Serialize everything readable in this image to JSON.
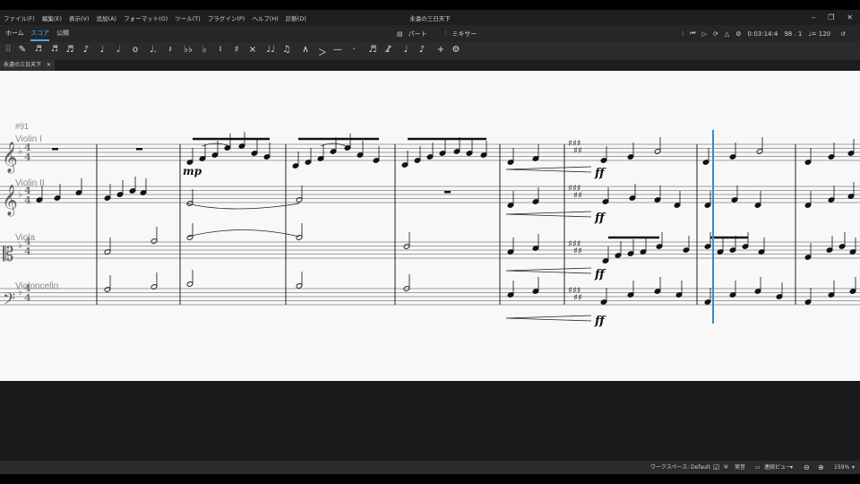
{
  "menu": [
    {
      "label": "ファイル(F)"
    },
    {
      "label": "編集(E)"
    },
    {
      "label": "表示(V)"
    },
    {
      "label": "追加(A)"
    },
    {
      "label": "フォーマット(O)"
    },
    {
      "label": "ツール(T)"
    },
    {
      "label": "プラグイン(P)"
    },
    {
      "label": "ヘルプ(H)"
    },
    {
      "label": "診断(D)"
    }
  ],
  "window": {
    "title": "永遠の三日天下",
    "minimize": "–",
    "restore": "❐",
    "close": "✕"
  },
  "tabs": {
    "home": "ホーム",
    "score": "スコア",
    "publish": "公開"
  },
  "center": {
    "parts": "パート",
    "mixer": "ミキサー"
  },
  "playback": {
    "time": "0:03:14:4",
    "position": "98 . 1",
    "tempo": "♩= 120"
  },
  "toolbar": {
    "items": [
      "✎",
      "𝅘𝅥𝅱",
      "𝅘𝅥𝅰",
      "𝅘𝅥𝅯",
      "♪",
      "♩",
      "𝅗𝅥",
      "𝅝",
      "♩.",
      "𝄽",
      "♭♭",
      "♭",
      "♮",
      "♯",
      "×",
      "♩♩",
      "♫",
      "∧",
      "＞",
      "—",
      "·",
      "♬",
      "♪̸",
      "♩",
      "♪",
      "+",
      "⚙"
    ]
  },
  "document_tab": {
    "label": "永遠の三日天下",
    "close": "✕"
  },
  "score": {
    "rehearsal": "#91",
    "instruments": [
      {
        "name": "Violin I"
      },
      {
        "name": "Violin II"
      },
      {
        "name": "Viola"
      },
      {
        "name": "Violoncello"
      }
    ],
    "dynamics": {
      "mp": "mp",
      "ff": "ff"
    }
  },
  "status": {
    "workspace": "ワークスペース: Default",
    "concert": "実音",
    "view": "連続ビュー",
    "zoom": "159%"
  }
}
